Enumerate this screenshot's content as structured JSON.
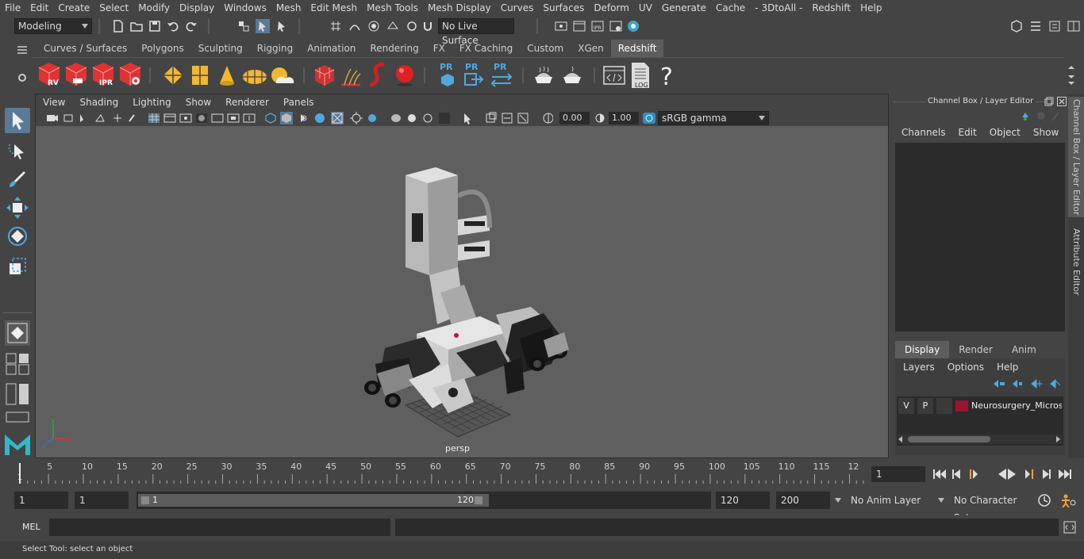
{
  "menubar": [
    "File",
    "Edit",
    "Create",
    "Select",
    "Modify",
    "Display",
    "Windows",
    "Mesh",
    "Edit Mesh",
    "Mesh Tools",
    "Mesh Display",
    "Curves",
    "Surfaces",
    "Deform",
    "UV",
    "Generate",
    "Cache",
    "- 3DtoAll -",
    "Redshift",
    "Help"
  ],
  "statusline": {
    "mode": "Modeling",
    "live_surface": "No Live Surface"
  },
  "shelf_tabs": [
    "Curves / Surfaces",
    "Polygons",
    "Sculpting",
    "Rigging",
    "Animation",
    "Rendering",
    "FX",
    "FX Caching",
    "Custom",
    "XGen",
    "Redshift"
  ],
  "shelf_active": "Redshift",
  "shelf_icons": {
    "rv": "RV",
    "ipr": "IPR",
    "pr1": "PR",
    "pr2": "PR",
    "pr3": "PR",
    "log": "LOG",
    "help": "?"
  },
  "viewport": {
    "menu": [
      "View",
      "Shading",
      "Lighting",
      "Show",
      "Renderer",
      "Panels"
    ],
    "exposure": "0.00",
    "gamma": "1.00",
    "colorspace": "sRGB gamma",
    "camera_label": "persp",
    "axis": {
      "x": "x",
      "y": "y",
      "z": "z"
    }
  },
  "channel_box": {
    "title": "Channel Box / Layer Editor",
    "menu": [
      "Channels",
      "Edit",
      "Object",
      "Show"
    ],
    "layer_tabs": [
      "Display",
      "Render",
      "Anim"
    ],
    "layer_tab_active": "Display",
    "layer_menu": [
      "Layers",
      "Options",
      "Help"
    ],
    "layer": {
      "v": "V",
      "p": "P",
      "name": "Neurosurgery_Microsc",
      "color": "#9b1530"
    }
  },
  "side_tabs": [
    "Channel Box / Layer Editor",
    "Attribute Editor"
  ],
  "timeline": {
    "ticks": [
      "5",
      "10",
      "15",
      "20",
      "25",
      "30",
      "35",
      "40",
      "45",
      "50",
      "55",
      "60",
      "65",
      "70",
      "75",
      "80",
      "85",
      "90",
      "95",
      "100",
      "105",
      "110",
      "115",
      "12"
    ],
    "start_tick": "1",
    "current_frame": "1"
  },
  "range": {
    "start": "1",
    "start2": "1",
    "slider_start": "1",
    "slider_end": "120",
    "end": "120",
    "end2": "200",
    "anim_layer": "No Anim Layer",
    "char_set": "No Character Set"
  },
  "cmd": {
    "label": "MEL"
  },
  "help_line": "Select Tool: select an object"
}
